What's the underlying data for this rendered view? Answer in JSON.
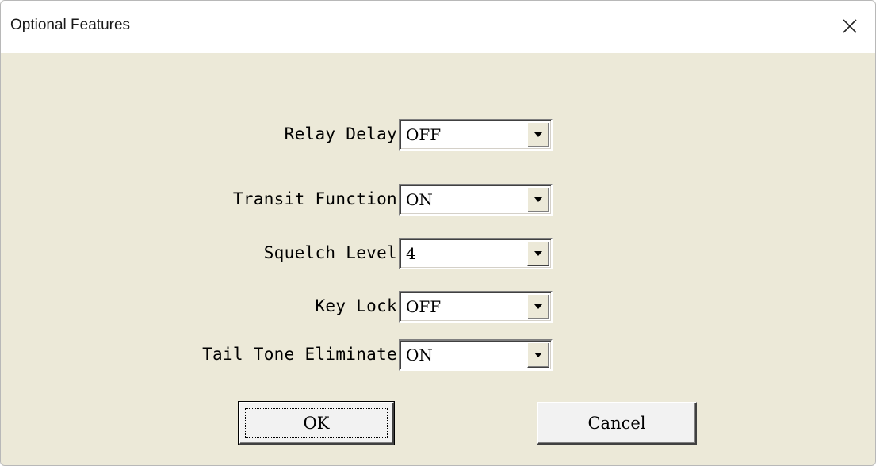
{
  "window": {
    "title": "Optional Features",
    "close_icon": "close-icon"
  },
  "fields": [
    {
      "label": "Relay Delay",
      "value": "OFF"
    },
    {
      "label": "Transit Function",
      "value": "ON"
    },
    {
      "label": "Squelch Level",
      "value": "4"
    },
    {
      "label": "Key Lock",
      "value": "OFF"
    },
    {
      "label": "Tail Tone Eliminate",
      "value": "ON"
    }
  ],
  "buttons": {
    "ok_label": "OK",
    "cancel_label": "Cancel"
  },
  "colors": {
    "dialog_background": "#ece9d8",
    "titlebar_background": "#ffffff"
  }
}
